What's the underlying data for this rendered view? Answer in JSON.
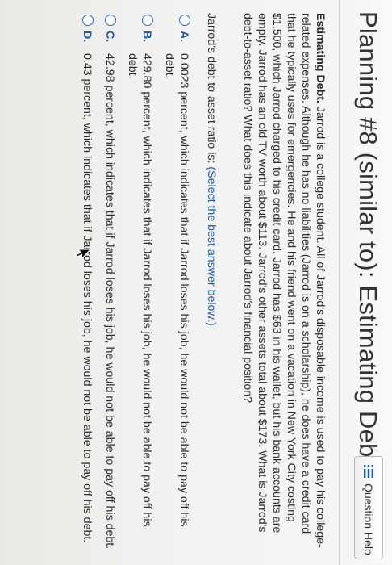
{
  "header": {
    "title": "Planning #8 (similar to): Estimating Deb",
    "help_label": "Question Help"
  },
  "problem": {
    "lead": "Estimating Debt.",
    "text": "Jarrod is a college student. All of Jarrod's disposable income is used to pay his college-related expenses. Although he has no liabilities (Jarrod is on a scholarship), he does have a credit card that he typically uses for emergencies. He and his friend went on a vacation in New York City costing $1,500, which Jarrod charged to his credit card. Jarrod has $63 in his wallet, but his bank accounts are empty. Jarrod has an old TV worth about $113. Jarrod's other assets total about $173. What is Jarrod's debt-to-asset ratio? What does this indicate about Jarrod's financial position?"
  },
  "prompt": {
    "text": "Jarrod's debt-to-asset ratio is:",
    "instruction": "(Select the best answer below.)"
  },
  "answers": [
    {
      "letter": "A.",
      "text": "0.0023 percent, which indicates that if Jarrod loses his job, he would not be able to pay off his debt."
    },
    {
      "letter": "B.",
      "text": "429.80 percent, which indicates that if Jarrod loses his job, he would not be able to pay off his debt."
    },
    {
      "letter": "C.",
      "text": "42.98 percent, which indicates that if Jarrod loses his job, he would not be able to pay off his debt."
    },
    {
      "letter": "D.",
      "text": "0.43 percent, which indicates that if Jarrod loses his job, he would not be able to pay off his debt."
    }
  ],
  "icons": {
    "help": "list-icon",
    "cursor": "mouse-pointer-icon"
  },
  "colors": {
    "accent": "#1d5aa8",
    "text": "#2c2c2c",
    "background": "#f3f3f1"
  }
}
